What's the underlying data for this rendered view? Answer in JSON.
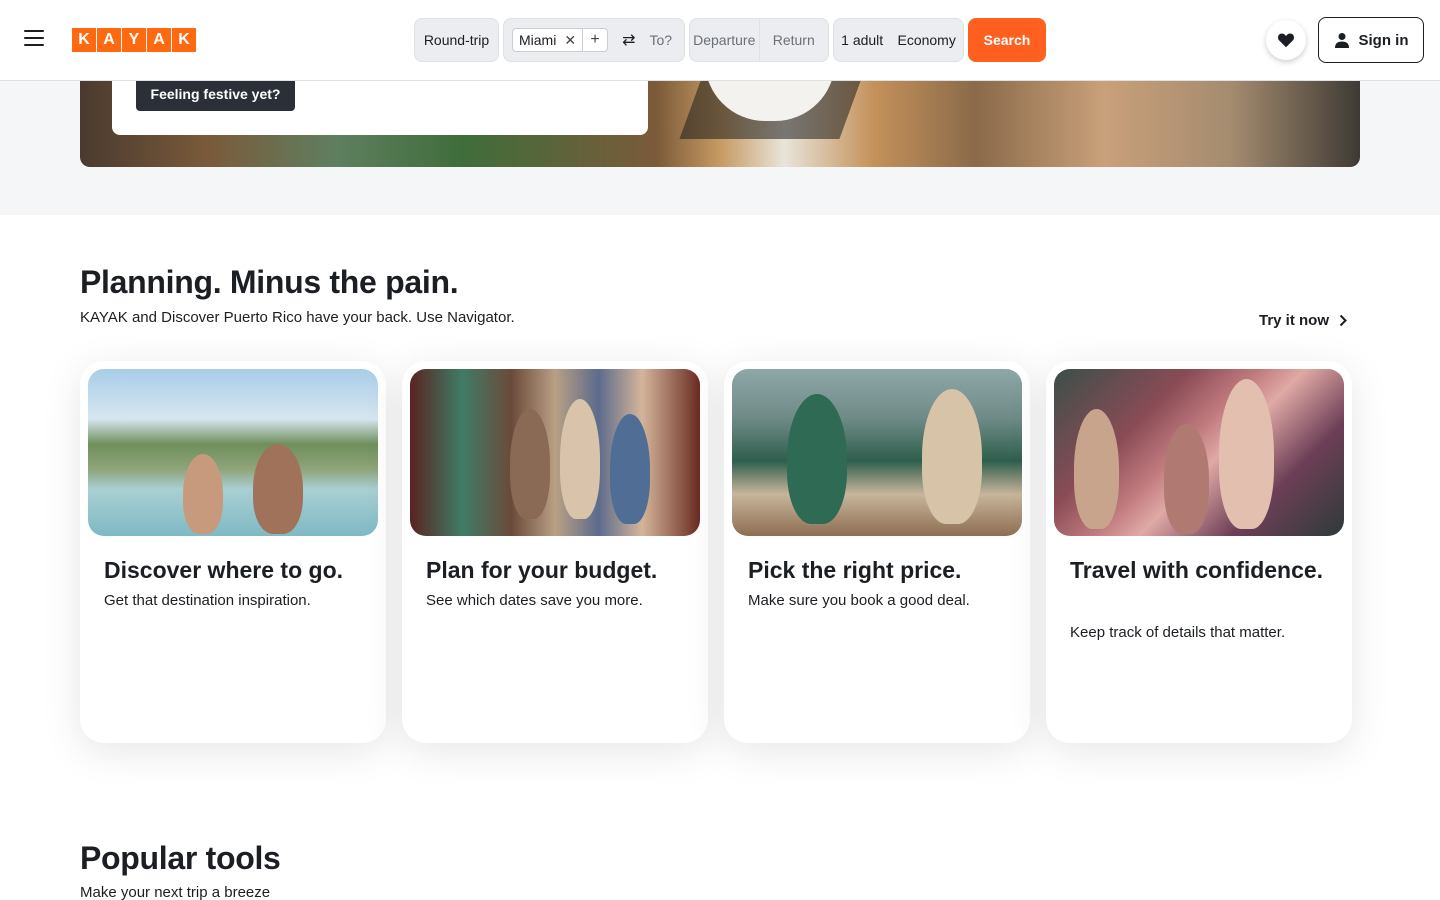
{
  "brand": {
    "letters": [
      "K",
      "A",
      "Y",
      "A",
      "K"
    ],
    "color": "#ff690f"
  },
  "search": {
    "trip_type": "Round-trip",
    "origin": "Miami",
    "destination_placeholder": "To?",
    "departure_placeholder": "Departure",
    "return_placeholder": "Return",
    "travelers": "1 adult",
    "cabin": "Economy",
    "button": "Search",
    "button_color": "#ff5f1f"
  },
  "account": {
    "sign_in": "Sign in"
  },
  "hero": {
    "badge": "Feeling festive yet?"
  },
  "planning": {
    "title": "Planning. Minus the pain.",
    "subtitle": "KAYAK and Discover Puerto Rico have your back. Use Navigator.",
    "cta": "Try it now",
    "cards": [
      {
        "title": "Discover where to go.",
        "text": "Get that destination inspiration."
      },
      {
        "title": "Plan for your budget.",
        "text": "See which dates save you more."
      },
      {
        "title": "Pick the right price.",
        "text": "Make sure you book a good deal."
      },
      {
        "title": "Travel with confidence.",
        "text": "Keep track of details that matter."
      }
    ]
  },
  "tools": {
    "title": "Popular tools",
    "subtitle": "Make your next trip a breeze"
  },
  "icons": [
    "menu-icon",
    "close-icon",
    "plus-icon",
    "swap-icon",
    "heart-icon",
    "user-icon",
    "chevron-right-icon"
  ]
}
